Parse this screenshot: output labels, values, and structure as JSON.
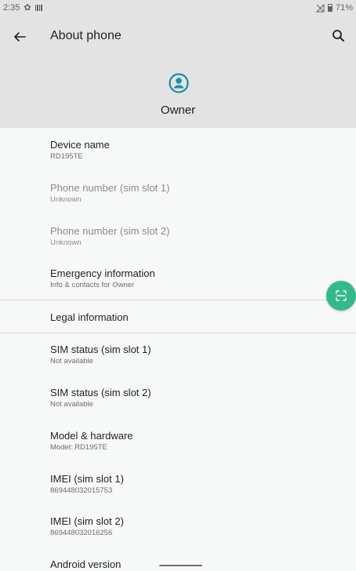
{
  "status_bar": {
    "time": "2:35",
    "battery_text": "71%"
  },
  "app_bar": {
    "title": "About phone"
  },
  "header": {
    "owner_name": "Owner",
    "accent_color": "#1a8fa5"
  },
  "items": [
    {
      "title": "Device name",
      "subtitle": "RD195TE",
      "enabled": true
    },
    {
      "title": "Phone number (sim slot 1)",
      "subtitle": "Unknown",
      "enabled": false
    },
    {
      "title": "Phone number (sim slot 2)",
      "subtitle": "Unknown",
      "enabled": false
    },
    {
      "title": "Emergency information",
      "subtitle": "Info & contacts for Owner",
      "enabled": true
    },
    {
      "title": "Legal information",
      "subtitle": "",
      "enabled": true
    },
    {
      "title": "SIM status (sim slot 1)",
      "subtitle": "Not available",
      "enabled": true
    },
    {
      "title": "SIM status (sim slot 2)",
      "subtitle": "Not available",
      "enabled": true
    },
    {
      "title": "Model & hardware",
      "subtitle": "Model: RD195TE",
      "enabled": true
    },
    {
      "title": "IMEI (sim slot 1)",
      "subtitle": "869448032015753",
      "enabled": true
    },
    {
      "title": "IMEI (sim slot 2)",
      "subtitle": "869448032016256",
      "enabled": true
    },
    {
      "title": "Android version",
      "subtitle": "",
      "enabled": true
    }
  ],
  "fab": {
    "icon": "scan-icon",
    "color": "#34b98a"
  }
}
